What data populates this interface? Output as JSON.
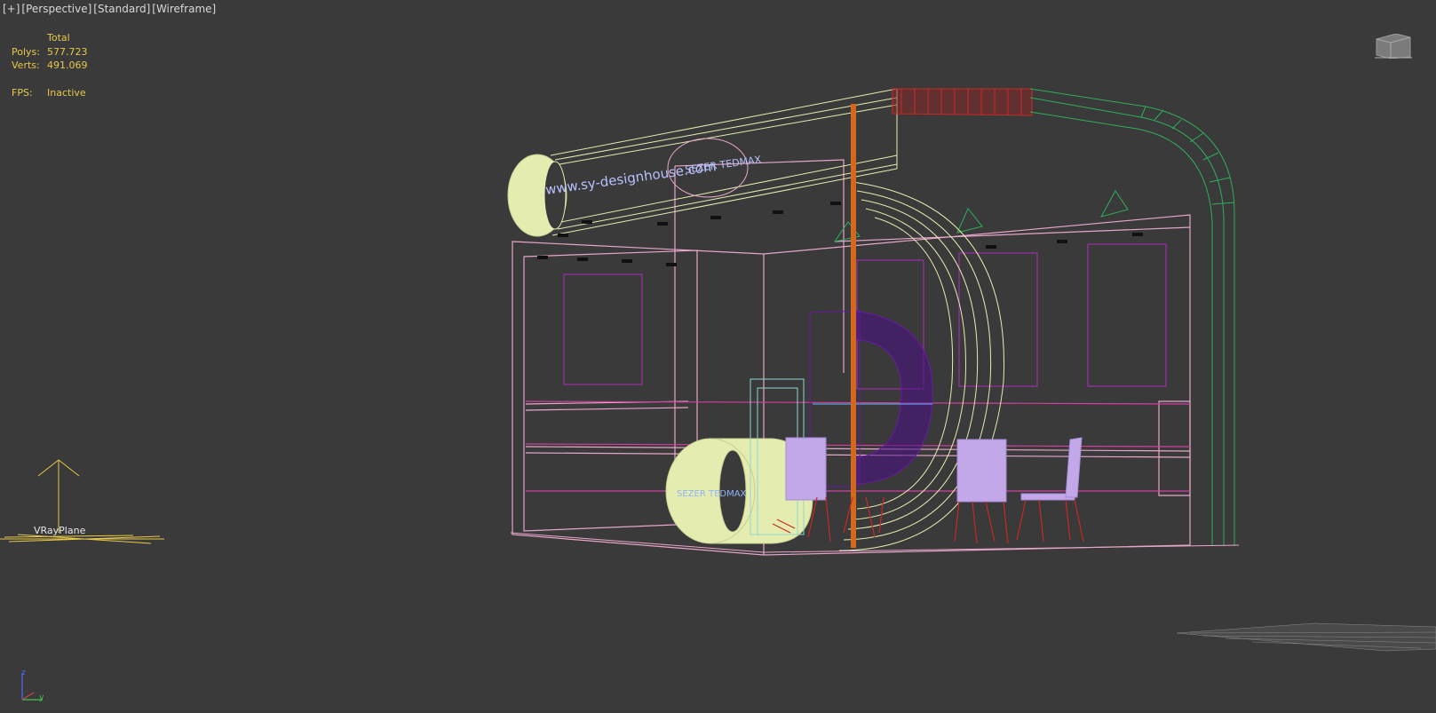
{
  "viewport": {
    "labels": [
      "[+]",
      "[Perspective]",
      "[Standard]",
      "[Wireframe]"
    ]
  },
  "stats": {
    "header": "Total",
    "polys_label": "Polys:",
    "polys_value": "577.723",
    "verts_label": "Verts:",
    "verts_value": "491.069",
    "fps_label": "FPS:",
    "fps_value": "Inactive"
  },
  "scene": {
    "helper_label": "VRayPlane",
    "banner_text": "www.sy-designhouse.com",
    "logo_text": "SEZER TEDMAX"
  },
  "axis_tripod": {
    "z_label": "z",
    "y_label": "y"
  },
  "colors": {
    "background": "#3a3a3a",
    "stats_text": "#e6c84a",
    "booth_outline_pink": "#e7a6c9",
    "cream_wire": "#e5ecb0",
    "green_wire": "#2fae5c",
    "red_wire": "#c82828",
    "purple_wire": "#6b18a8",
    "orange_post": "#d2691e",
    "lilac_furniture": "#c2a8e8"
  }
}
